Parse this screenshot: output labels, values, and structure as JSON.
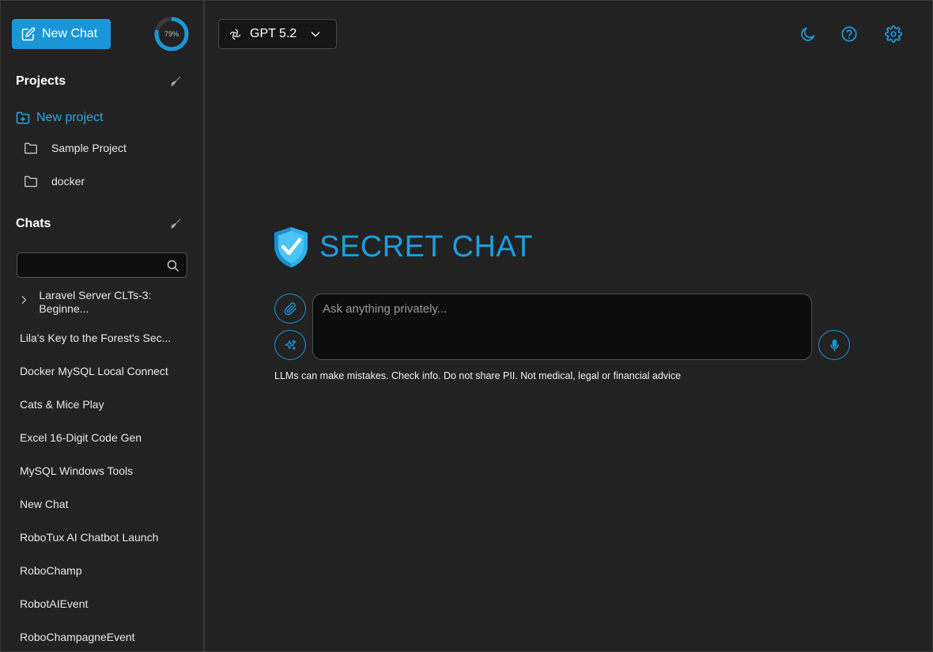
{
  "sidebar": {
    "new_chat_label": "New Chat",
    "usage": "79%",
    "usage_fraction": 0.79,
    "projects_title": "Projects",
    "new_project_label": "New project",
    "projects": [
      "Sample Project",
      "docker"
    ],
    "chats_title": "Chats",
    "search_value": "",
    "chats": [
      "Laravel Server CLTs-3: Beginne...",
      "Lila's Key to the Forest's Sec...",
      "Docker MySQL Local Connect",
      "Cats & Mice Play",
      "Excel 16-Digit Code Gen",
      "MySQL Windows Tools",
      "New Chat",
      "RoboTux AI Chatbot Launch",
      "RoboChamp",
      "RobotAIEvent",
      "RoboChampagneEvent"
    ]
  },
  "header": {
    "model_label": "GPT 5.2",
    "icons": [
      "moon-icon",
      "help-icon",
      "settings-icon"
    ]
  },
  "main": {
    "brand": "SECRET CHAT",
    "prompt_placeholder": "Ask anything privately...",
    "disclaimer": "LLMs can make mistakes. Check info. Do not share PII. Not medical, legal or financial advice"
  },
  "colors": {
    "accent": "#1a96d8",
    "background": "#222222",
    "input_background": "#0d0d0d"
  }
}
